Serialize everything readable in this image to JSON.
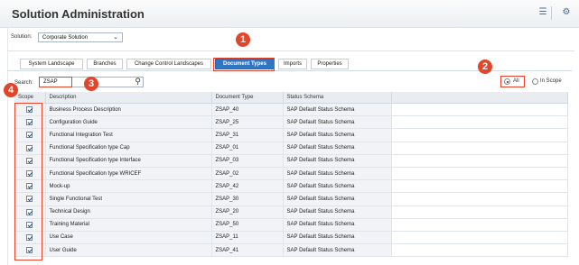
{
  "header": {
    "title": "Solution Administration"
  },
  "solution": {
    "label": "Solution:",
    "selected": "Corporate Solution"
  },
  "tabs": [
    {
      "label": "System Landscape"
    },
    {
      "label": "Branches"
    },
    {
      "label": "Change Control Landscapes"
    },
    {
      "label": "Document Types",
      "active": true
    },
    {
      "label": "Imports"
    },
    {
      "label": "Properties"
    }
  ],
  "search": {
    "label": "Search:",
    "value": "ZSAP"
  },
  "filter": {
    "all_label": "All",
    "inscope_label": "In Scope",
    "selected": "All"
  },
  "table": {
    "headers": {
      "scope": "Scope",
      "description": "Description",
      "type": "Document Type",
      "schema": "Status Schema"
    },
    "rows": [
      {
        "description": "Business Process Description",
        "type": "ZSAP_40",
        "schema": "SAP Default Status Schema",
        "checked": true
      },
      {
        "description": "Configuration Guide",
        "type": "ZSAP_25",
        "schema": "SAP Default Status Schema",
        "checked": true
      },
      {
        "description": "Functional Integration Test",
        "type": "ZSAP_31",
        "schema": "SAP Default Status Schema",
        "checked": true
      },
      {
        "description": "Functional Specification type Cap",
        "type": "ZSAP_01",
        "schema": "SAP Default Status Schema",
        "checked": true
      },
      {
        "description": "Functional Specification type Interface",
        "type": "ZSAP_03",
        "schema": "SAP Default Status Schema",
        "checked": true
      },
      {
        "description": "Functional Specification type WRICEF",
        "type": "ZSAP_02",
        "schema": "SAP Default Status Schema",
        "checked": true
      },
      {
        "description": "Mock-up",
        "type": "ZSAP_42",
        "schema": "SAP Default Status Schema",
        "checked": true
      },
      {
        "description": "Single Functional Test",
        "type": "ZSAP_30",
        "schema": "SAP Default Status Schema",
        "checked": true
      },
      {
        "description": "Technical Design",
        "type": "ZSAP_20",
        "schema": "SAP Default Status Schema",
        "checked": true
      },
      {
        "description": "Training Material",
        "type": "ZSAP_50",
        "schema": "SAP Default Status Schema",
        "checked": true
      },
      {
        "description": "Use Case",
        "type": "ZSAP_11",
        "schema": "SAP Default Status Schema",
        "checked": true
      },
      {
        "description": "User Guide",
        "type": "ZSAP_41",
        "schema": "SAP Default Status Schema",
        "checked": true
      }
    ]
  },
  "callouts": [
    "1",
    "2",
    "3",
    "4"
  ],
  "icons": {
    "list": "list-icon",
    "help": "help-icon",
    "search": "search-icon",
    "dropdown": "chevron-down-icon"
  },
  "colors": {
    "active_tab": "#2f75c2",
    "callout": "#e2452a"
  }
}
